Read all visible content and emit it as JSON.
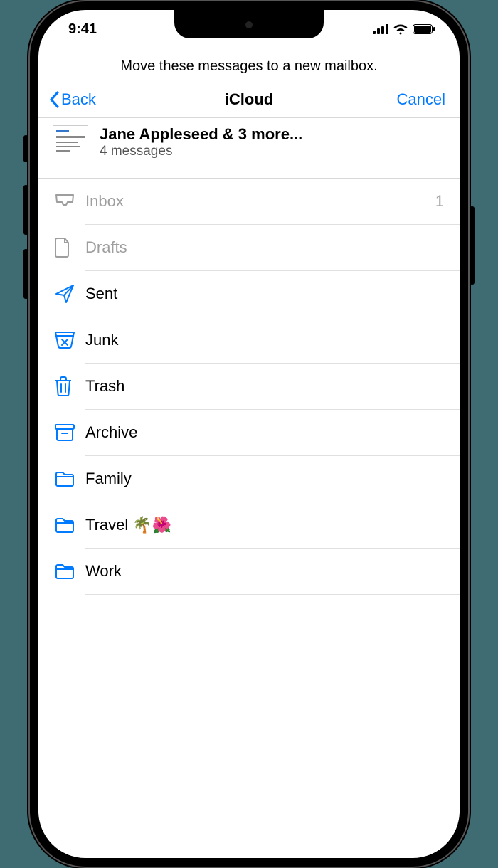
{
  "status": {
    "time": "9:41"
  },
  "instruction": "Move these messages to a new mailbox.",
  "nav": {
    "back": "Back",
    "title": "iCloud",
    "cancel": "Cancel"
  },
  "selection": {
    "title": "Jane Appleseed & 3 more...",
    "subtitle": "4 messages"
  },
  "mailboxes": [
    {
      "icon": "inbox",
      "label": "Inbox",
      "count": "1",
      "disabled": true
    },
    {
      "icon": "doc",
      "label": "Drafts",
      "count": "",
      "disabled": true
    },
    {
      "icon": "send",
      "label": "Sent",
      "count": "",
      "disabled": false
    },
    {
      "icon": "junk",
      "label": "Junk",
      "count": "",
      "disabled": false
    },
    {
      "icon": "trash",
      "label": "Trash",
      "count": "",
      "disabled": false
    },
    {
      "icon": "archive",
      "label": "Archive",
      "count": "",
      "disabled": false
    },
    {
      "icon": "folder",
      "label": "Family",
      "count": "",
      "disabled": false
    },
    {
      "icon": "folder",
      "label": "Travel 🌴🌺",
      "count": "",
      "disabled": false
    },
    {
      "icon": "folder",
      "label": "Work",
      "count": "",
      "disabled": false
    }
  ],
  "colors": {
    "accent": "#007aff",
    "muted": "#9e9e9e"
  }
}
